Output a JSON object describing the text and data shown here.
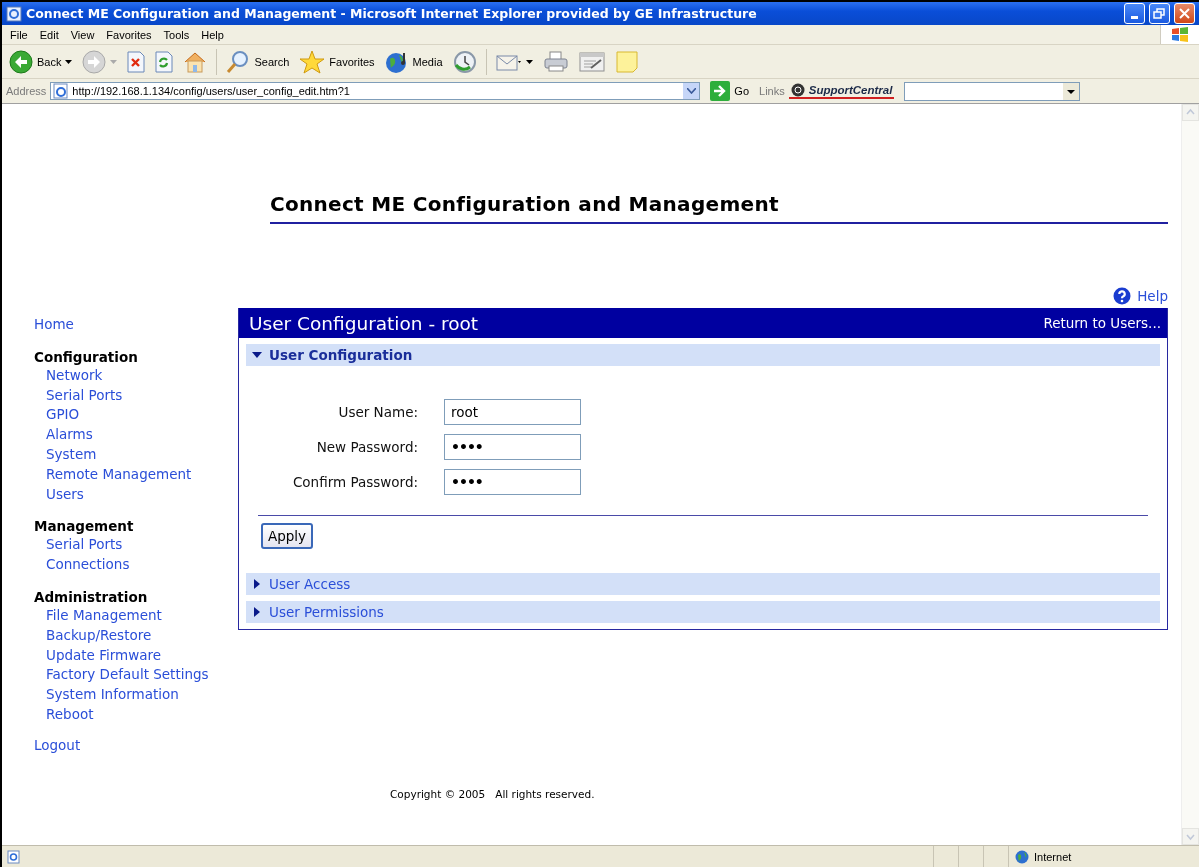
{
  "window": {
    "title": "Connect ME Configuration and Management - Microsoft Internet Explorer provided by GE Infrastructure"
  },
  "menu_bar": [
    "File",
    "Edit",
    "View",
    "Favorites",
    "Tools",
    "Help"
  ],
  "toolbar": {
    "labels": [
      "Back",
      "Search",
      "Favorites",
      "Media"
    ]
  },
  "address_bar": {
    "label": "Address",
    "url": "http://192.168.1.134/config/users/user_config_edit.htm?1",
    "go": "Go",
    "links": "Links",
    "link_item": "SupportCentral"
  },
  "page": {
    "heading": "Connect ME Configuration and Management",
    "help": "Help",
    "nav": [
      {
        "kind": "link",
        "label": "Home"
      },
      {
        "kind": "group",
        "title": "Configuration",
        "items": [
          "Network",
          "Serial Ports",
          "GPIO",
          "Alarms",
          "System",
          "Remote Management",
          "Users"
        ]
      },
      {
        "kind": "group",
        "title": "Management",
        "items": [
          "Serial Ports",
          "Connections"
        ]
      },
      {
        "kind": "group",
        "title": "Administration",
        "items": [
          "File Management",
          "Backup/Restore",
          "Update Firmware",
          "Factory Default Settings",
          "System Information",
          "Reboot"
        ]
      },
      {
        "kind": "link",
        "label": "Logout"
      }
    ],
    "panel": {
      "title": "User Configuration - root",
      "return_link": "Return to Users...",
      "sections": [
        {
          "title": "User Configuration",
          "expanded": true,
          "fields": [
            {
              "label": "User Name:",
              "value": "root",
              "kind": "text"
            },
            {
              "label": "New Password:",
              "value": "••••",
              "kind": "password"
            },
            {
              "label": "Confirm Password:",
              "value": "••••",
              "kind": "password"
            }
          ],
          "button": "Apply"
        },
        {
          "title": "User Access",
          "expanded": false
        },
        {
          "title": "User Permissions",
          "expanded": false
        }
      ]
    },
    "copyright": "Copyright © 2005   All rights reserved."
  },
  "status_bar": {
    "zone": "Internet"
  }
}
